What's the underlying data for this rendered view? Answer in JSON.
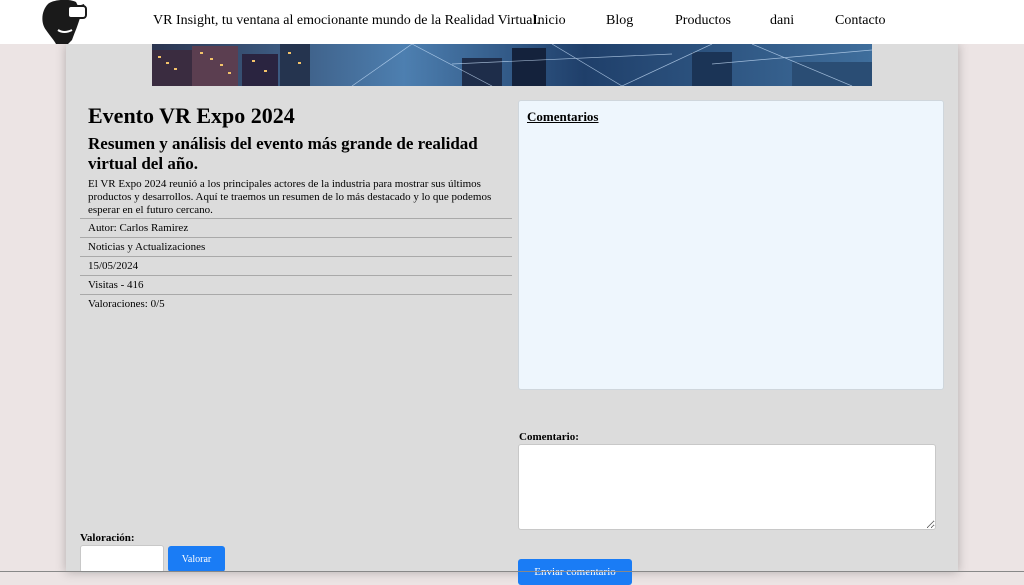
{
  "header": {
    "logo_icon": "vr-headset-head-icon",
    "tagline": "VR Insight, tu ventana al emocionante mundo de la Realidad Virtual.",
    "nav": [
      {
        "label": "Inicio"
      },
      {
        "label": "Blog"
      },
      {
        "label": "Productos"
      },
      {
        "label": "dani"
      },
      {
        "label": "Contacto"
      }
    ]
  },
  "post": {
    "title": "Evento VR Expo 2024",
    "subtitle": "Resumen y análisis del evento más grande de realidad virtual del año.",
    "body": "El VR Expo 2024 reunió a los principales actores de la industria para mostrar sus últimos productos y desarrollos. Aquí te traemos un resumen de lo más destacado y lo que podemos esperar en el futuro cercano.",
    "meta": [
      "Autor: Carlos Ramirez",
      "Noticias y Actualizaciones",
      "15/05/2024",
      "Visitas - 416",
      "Valoraciones: 0/5"
    ]
  },
  "comments": {
    "title": "Comentarios",
    "form_label": "Comentario:",
    "submit_label": "Enviar comentario"
  },
  "rating": {
    "label": "Valoración:",
    "button_label": "Valorar"
  },
  "colors": {
    "accent": "#1a7cf5",
    "page_bg": "#ece4e4",
    "panel_bg": "#dcdcdc",
    "comments_bg": "#eef6fd"
  }
}
